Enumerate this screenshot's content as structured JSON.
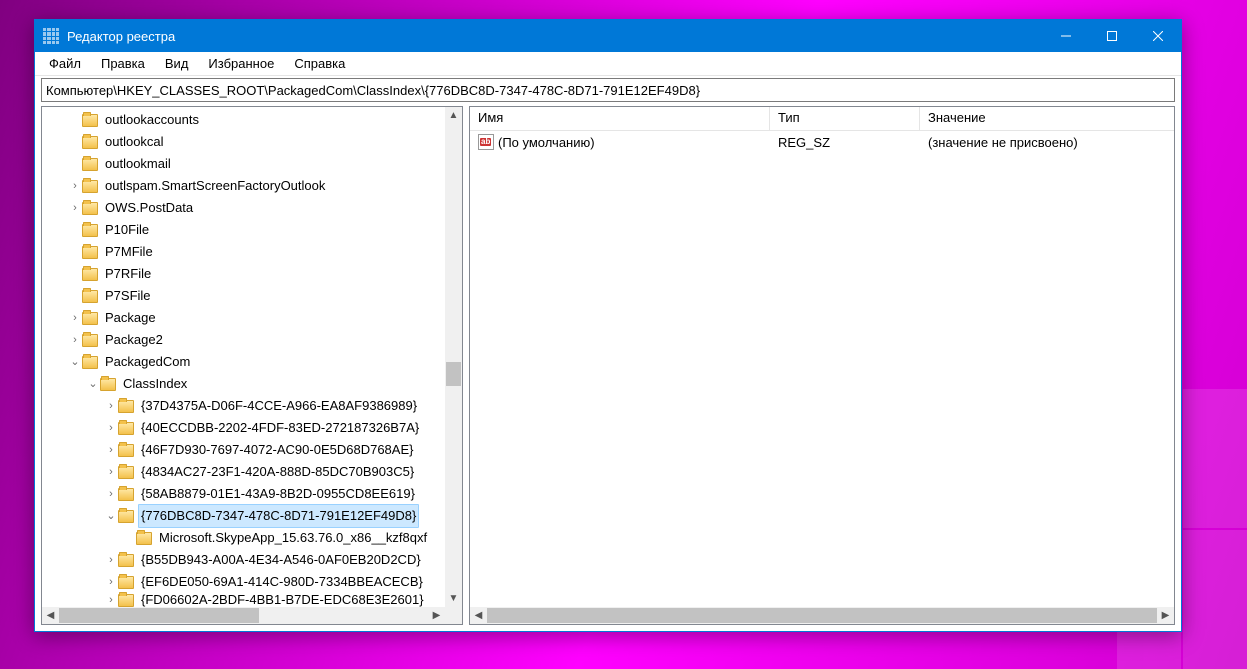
{
  "window": {
    "title": "Редактор реестра"
  },
  "menubar": {
    "file": "Файл",
    "edit": "Правка",
    "view": "Вид",
    "favorites": "Избранное",
    "help": "Справка"
  },
  "address": "Компьютер\\HKEY_CLASSES_ROOT\\PackagedCom\\ClassIndex\\{776DBC8D-7347-478C-8D71-791E12EF49D8}",
  "tree": [
    {
      "depth": 1,
      "expander": "none",
      "label": "outlookaccounts"
    },
    {
      "depth": 1,
      "expander": "none",
      "label": "outlookcal"
    },
    {
      "depth": 1,
      "expander": "none",
      "label": "outlookmail"
    },
    {
      "depth": 1,
      "expander": "closed",
      "label": "outlspam.SmartScreenFactoryOutlook"
    },
    {
      "depth": 1,
      "expander": "closed",
      "label": "OWS.PostData"
    },
    {
      "depth": 1,
      "expander": "none",
      "label": "P10File"
    },
    {
      "depth": 1,
      "expander": "none",
      "label": "P7MFile"
    },
    {
      "depth": 1,
      "expander": "none",
      "label": "P7RFile"
    },
    {
      "depth": 1,
      "expander": "none",
      "label": "P7SFile"
    },
    {
      "depth": 1,
      "expander": "closed",
      "label": "Package"
    },
    {
      "depth": 1,
      "expander": "closed",
      "label": "Package2"
    },
    {
      "depth": 1,
      "expander": "open",
      "label": "PackagedCom"
    },
    {
      "depth": 2,
      "expander": "open",
      "label": "ClassIndex"
    },
    {
      "depth": 3,
      "expander": "closed",
      "label": "{37D4375A-D06F-4CCE-A966-EA8AF9386989}"
    },
    {
      "depth": 3,
      "expander": "closed",
      "label": "{40ECCDBB-2202-4FDF-83ED-272187326B7A}"
    },
    {
      "depth": 3,
      "expander": "closed",
      "label": "{46F7D930-7697-4072-AC90-0E5D68D768AE}"
    },
    {
      "depth": 3,
      "expander": "closed",
      "label": "{4834AC27-23F1-420A-888D-85DC70B903C5}"
    },
    {
      "depth": 3,
      "expander": "closed",
      "label": "{58AB8879-01E1-43A9-8B2D-0955CD8EE619}"
    },
    {
      "depth": 3,
      "expander": "open",
      "label": "{776DBC8D-7347-478C-8D71-791E12EF49D8}",
      "selected": true
    },
    {
      "depth": 4,
      "expander": "none",
      "label": "Microsoft.SkypeApp_15.63.76.0_x86__kzf8qxf"
    },
    {
      "depth": 3,
      "expander": "closed",
      "label": "{B55DB943-A00A-4E34-A546-0AF0EB20D2CD}"
    },
    {
      "depth": 3,
      "expander": "closed",
      "label": "{EF6DE050-69A1-414C-980D-7334BBEACECB}"
    },
    {
      "depth": 3,
      "expander": "closed",
      "label": "{FD06602A-2BDF-4BB1-B7DE-EDC68E3E2601}",
      "cut": true
    }
  ],
  "columns": {
    "name": "Имя",
    "type": "Тип",
    "value": "Значение"
  },
  "values": [
    {
      "name": "(По умолчанию)",
      "type": "REG_SZ",
      "value": "(значение не присвоено)"
    }
  ]
}
